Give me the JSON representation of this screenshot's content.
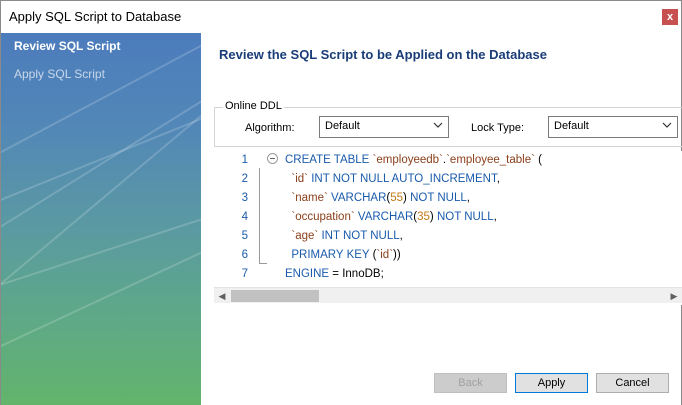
{
  "window": {
    "title": "Apply SQL Script to Database",
    "close_glyph": "x"
  },
  "sidebar": {
    "items": [
      {
        "label": "Review SQL Script",
        "active": true
      },
      {
        "label": "Apply SQL Script",
        "active": false
      }
    ]
  },
  "main": {
    "title": "Review the SQL Script to be Applied on the Database",
    "online_ddl": {
      "legend": "Online DDL",
      "algorithm_label": "Algorithm:",
      "algorithm_value": "Default",
      "lock_type_label": "Lock Type:",
      "lock_type_value": "Default"
    },
    "script_lines": [
      {
        "n": "1",
        "tokens": [
          [
            "kw",
            "CREATE TABLE "
          ],
          [
            "id",
            "`employeedb`"
          ],
          [
            "pl",
            "."
          ],
          [
            "id",
            "`employee_table`"
          ],
          [
            "pl",
            " ("
          ]
        ]
      },
      {
        "n": "2",
        "tokens": [
          [
            "id",
            "  `id`"
          ],
          [
            "kw",
            " INT NOT NULL AUTO_INCREMENT"
          ],
          [
            "pl",
            ","
          ]
        ]
      },
      {
        "n": "3",
        "tokens": [
          [
            "id",
            "  `name`"
          ],
          [
            "kw",
            " VARCHAR"
          ],
          [
            "pl",
            "("
          ],
          [
            "num",
            "55"
          ],
          [
            "pl",
            ") "
          ],
          [
            "kw",
            "NOT NULL"
          ],
          [
            "pl",
            ","
          ]
        ]
      },
      {
        "n": "4",
        "tokens": [
          [
            "id",
            "  `occupation`"
          ],
          [
            "kw",
            " VARCHAR"
          ],
          [
            "pl",
            "("
          ],
          [
            "num",
            "35"
          ],
          [
            "pl",
            ") "
          ],
          [
            "kw",
            "NOT NULL"
          ],
          [
            "pl",
            ","
          ]
        ]
      },
      {
        "n": "5",
        "tokens": [
          [
            "id",
            "  `age`"
          ],
          [
            "kw",
            " INT NOT NULL"
          ],
          [
            "pl",
            ","
          ]
        ]
      },
      {
        "n": "6",
        "tokens": [
          [
            "kw",
            "  PRIMARY KEY "
          ],
          [
            "pl",
            "("
          ],
          [
            "id",
            "`id`"
          ],
          [
            "pl",
            "))"
          ]
        ]
      },
      {
        "n": "7",
        "tokens": [
          [
            "kw",
            "ENGINE "
          ],
          [
            "pl",
            "= InnoDB;"
          ]
        ]
      }
    ]
  },
  "buttons": {
    "back": "Back",
    "apply": "Apply",
    "cancel": "Cancel"
  },
  "colors": {
    "title_accent": "#1a3d78",
    "keyword": "#1a5bab",
    "identifier": "#8a3f1a",
    "number": "#c47a19"
  }
}
